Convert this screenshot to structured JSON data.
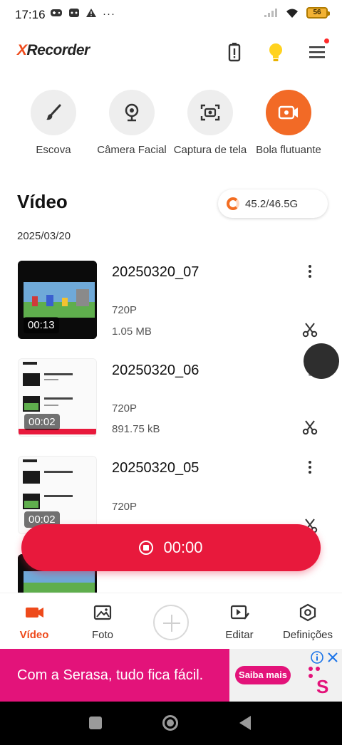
{
  "status_bar": {
    "time": "17:16",
    "battery": "56"
  },
  "app": {
    "logo_x": "X",
    "logo_rest": "Recorder",
    "accent": "#ee4a1b"
  },
  "tools": [
    {
      "label": "Escova",
      "icon": "brush-icon"
    },
    {
      "label": "Câmera Facial",
      "icon": "webcam-icon"
    },
    {
      "label": "Captura de tela",
      "icon": "screenshot-icon"
    },
    {
      "label": "Bola flutuante",
      "icon": "floating-ball-icon"
    }
  ],
  "section": {
    "title": "Vídeo",
    "storage": "45.2/46.5G",
    "date": "2025/03/20"
  },
  "videos": [
    {
      "title": "20250320_07",
      "duration": "00:13",
      "resolution": "720P",
      "size": "1.05 MB"
    },
    {
      "title": "20250320_06",
      "duration": "00:02",
      "resolution": "720P",
      "size": "891.75 kB"
    },
    {
      "title": "20250320_05",
      "duration": "00:02",
      "resolution": "720P",
      "size": ""
    }
  ],
  "record": {
    "time": "00:00"
  },
  "bottom_nav": [
    {
      "label": "Vídeo",
      "icon": "video-camera-icon"
    },
    {
      "label": "Foto",
      "icon": "photo-icon"
    },
    {
      "label": "Editar",
      "icon": "edit-video-icon"
    },
    {
      "label": "Definições",
      "icon": "settings-hex-icon"
    }
  ],
  "ad": {
    "text": "Com a Serasa, tudo fica fácil.",
    "cta": "Saiba mais",
    "brand_color": "#e3137a"
  }
}
